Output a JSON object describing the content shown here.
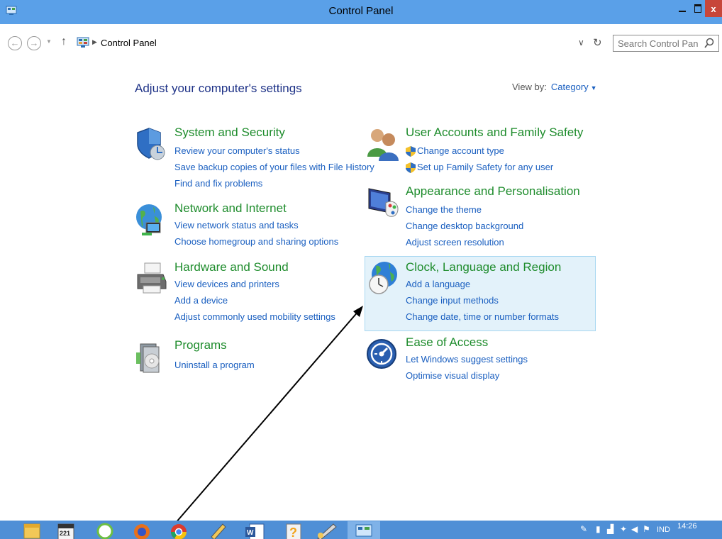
{
  "window": {
    "title": "Control Panel",
    "close_glyph": "x"
  },
  "address": {
    "breadcrumb": "Control Panel",
    "search_placeholder": "Search Control Panel"
  },
  "main": {
    "heading": "Adjust your computer's settings",
    "view_by_label": "View by:",
    "view_by_value": "Category"
  },
  "categories": {
    "system_security": {
      "title": "System and Security",
      "links": [
        "Review your computer's status",
        "Save backup copies of your files with File History",
        "Find and fix problems"
      ]
    },
    "network_internet": {
      "title": "Network and Internet",
      "links": [
        "View network status and tasks",
        "Choose homegroup and sharing options"
      ]
    },
    "hardware_sound": {
      "title": "Hardware and Sound",
      "links": [
        "View devices and printers",
        "Add a device",
        "Adjust commonly used mobility settings"
      ]
    },
    "programs": {
      "title": "Programs",
      "links": [
        "Uninstall a program"
      ]
    },
    "user_accounts": {
      "title": "User Accounts and Family Safety",
      "links": [
        "Change account type",
        "Set up Family Safety for any user"
      ]
    },
    "appearance": {
      "title": "Appearance and Personalisation",
      "links": [
        "Change the theme",
        "Change desktop background",
        "Adjust screen resolution"
      ]
    },
    "clock_region": {
      "title": "Clock, Language and Region",
      "links": [
        "Add a language",
        "Change input methods",
        "Change date, time or number formats"
      ]
    },
    "ease_access": {
      "title": "Ease of Access",
      "links": [
        "Let Windows suggest settings",
        "Optimise visual display"
      ]
    }
  },
  "taskbar": {
    "calendar_day": "221",
    "language": "IND",
    "time": "14:26"
  },
  "colors": {
    "titlebar": "#5aa0e8",
    "taskbar": "#4f8fd6",
    "category_title": "#1e8c2c",
    "link": "#1a5fc0",
    "highlight": "#e3f2fa",
    "close_button": "#c7463a"
  },
  "icons": [
    "control-panel-icon",
    "back-arrow-icon",
    "forward-arrow-icon",
    "up-arrow-icon",
    "refresh-icon",
    "search-icon",
    "shield-icon",
    "uac-shield-icon",
    "network-globe-icon",
    "printer-icon",
    "programs-icon",
    "users-icon",
    "monitor-palette-icon",
    "clock-globe-icon",
    "ease-of-access-icon",
    "file-explorer-icon",
    "calendar-icon",
    "firefox-icon",
    "chrome-icon",
    "word-icon",
    "help-icon",
    "control-panel-taskbar-icon"
  ]
}
